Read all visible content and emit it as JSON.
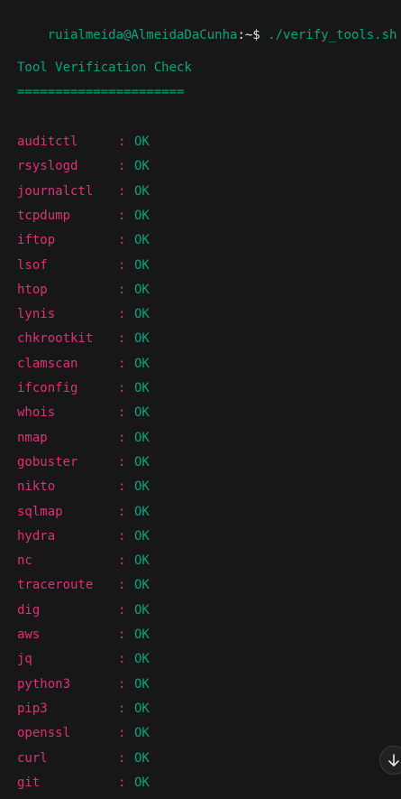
{
  "prompt": {
    "user_host": "ruialmeida@AlmeidaDaCunha",
    "separator": ":~$ ",
    "command": "./verify_tools.sh"
  },
  "header": {
    "title": "Tool Verification Check",
    "underline": "======================"
  },
  "separator": ": ",
  "tools": [
    {
      "name": "auditctl",
      "status": "OK"
    },
    {
      "name": "rsyslogd",
      "status": "OK"
    },
    {
      "name": "journalctl",
      "status": "OK"
    },
    {
      "name": "tcpdump",
      "status": "OK"
    },
    {
      "name": "iftop",
      "status": "OK"
    },
    {
      "name": "lsof",
      "status": "OK"
    },
    {
      "name": "htop",
      "status": "OK"
    },
    {
      "name": "lynis",
      "status": "OK"
    },
    {
      "name": "chkrootkit",
      "status": "OK"
    },
    {
      "name": "clamscan",
      "status": "OK"
    },
    {
      "name": "ifconfig",
      "status": "OK"
    },
    {
      "name": "whois",
      "status": "OK"
    },
    {
      "name": "nmap",
      "status": "OK"
    },
    {
      "name": "gobuster",
      "status": "OK"
    },
    {
      "name": "nikto",
      "status": "OK"
    },
    {
      "name": "sqlmap",
      "status": "OK"
    },
    {
      "name": "hydra",
      "status": "OK"
    },
    {
      "name": "nc",
      "status": "OK"
    },
    {
      "name": "traceroute",
      "status": "OK"
    },
    {
      "name": "dig",
      "status": "OK"
    },
    {
      "name": "aws",
      "status": "OK"
    },
    {
      "name": "jq",
      "status": "OK"
    },
    {
      "name": "python3",
      "status": "OK"
    },
    {
      "name": "pip3",
      "status": "OK"
    },
    {
      "name": "openssl",
      "status": "OK"
    },
    {
      "name": "curl",
      "status": "OK"
    },
    {
      "name": "git",
      "status": "OK"
    }
  ],
  "scroll_button": {
    "icon": "arrow-down-icon"
  },
  "colors": {
    "background": "#171717",
    "green": "#00a67d",
    "pink": "#df3079"
  }
}
